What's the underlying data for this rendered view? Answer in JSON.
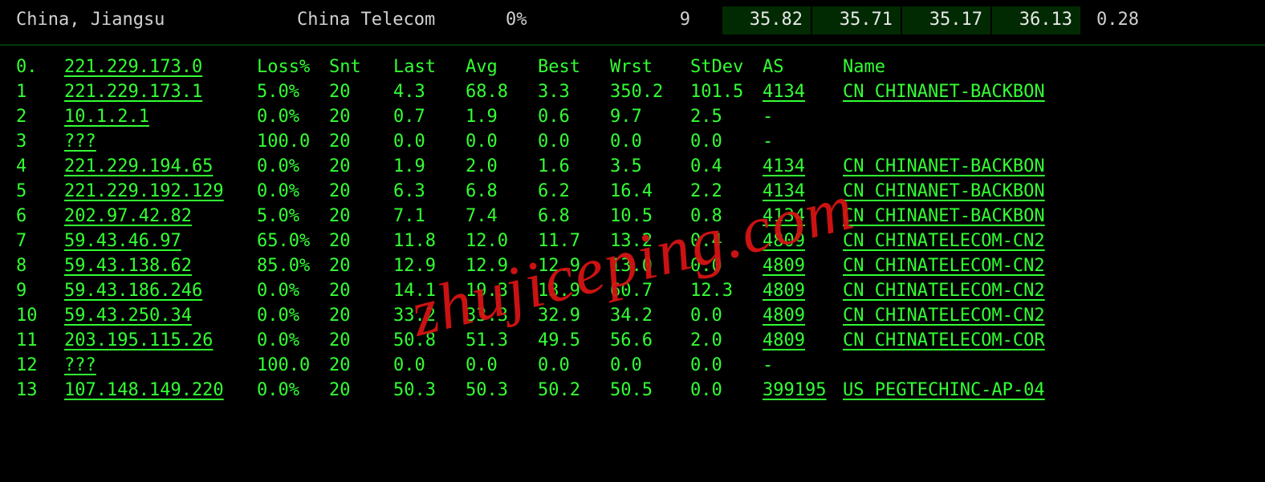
{
  "top": {
    "location": "China, Jiangsu",
    "isp": "China Telecom",
    "loss": "0%",
    "snt": "9",
    "stats": [
      "35.82",
      "35.71",
      "35.17",
      "36.13"
    ],
    "last": "0.28"
  },
  "headers": {
    "hop": "0.",
    "host": "221.229.173.0",
    "loss": "Loss%",
    "snt": "Snt",
    "last": "Last",
    "avg": "Avg",
    "best": "Best",
    "wrst": "Wrst",
    "stdev": "StDev",
    "asn": "AS",
    "asname": "Name"
  },
  "hops": [
    {
      "n": "1",
      "host": "221.229.173.1",
      "u": true,
      "loss": "5.0%",
      "snt": "20",
      "last": "4.3",
      "avg": "68.8",
      "best": "3.3",
      "wrst": "350.2",
      "stdev": "101.5",
      "asn": "4134",
      "asu": true,
      "asname": "CN CHINANET-BACKBON"
    },
    {
      "n": "2",
      "host": "10.1.2.1",
      "u": true,
      "loss": "0.0%",
      "snt": "20",
      "last": "0.7",
      "avg": "1.9",
      "best": "0.6",
      "wrst": "9.7",
      "stdev": "2.5",
      "asn": "-",
      "asu": false,
      "asname": ""
    },
    {
      "n": "3",
      "host": "???",
      "u": true,
      "loss": "100.0",
      "snt": "20",
      "last": "0.0",
      "avg": "0.0",
      "best": "0.0",
      "wrst": "0.0",
      "stdev": "0.0",
      "asn": "-",
      "asu": false,
      "asname": ""
    },
    {
      "n": "4",
      "host": "221.229.194.65",
      "u": true,
      "loss": "0.0%",
      "snt": "20",
      "last": "1.9",
      "avg": "2.0",
      "best": "1.6",
      "wrst": "3.5",
      "stdev": "0.4",
      "asn": "4134",
      "asu": true,
      "asname": "CN CHINANET-BACKBON"
    },
    {
      "n": "5",
      "host": "221.229.192.129",
      "u": true,
      "loss": "0.0%",
      "snt": "20",
      "last": "6.3",
      "avg": "6.8",
      "best": "6.2",
      "wrst": "16.4",
      "stdev": "2.2",
      "asn": "4134",
      "asu": true,
      "asname": "CN CHINANET-BACKBON"
    },
    {
      "n": "6",
      "host": "202.97.42.82",
      "u": true,
      "loss": "5.0%",
      "snt": "20",
      "last": "7.1",
      "avg": "7.4",
      "best": "6.8",
      "wrst": "10.5",
      "stdev": "0.8",
      "asn": "4134",
      "asu": true,
      "asname": "CN CHINANET-BACKBON"
    },
    {
      "n": "7",
      "host": "59.43.46.97",
      "u": true,
      "loss": "65.0%",
      "snt": "20",
      "last": "11.8",
      "avg": "12.0",
      "best": "11.7",
      "wrst": "13.2",
      "stdev": "0.4",
      "asn": "4809",
      "asu": true,
      "asname": "CN CHINATELECOM-CN2"
    },
    {
      "n": "8",
      "host": "59.43.138.62",
      "u": true,
      "loss": "85.0%",
      "snt": "20",
      "last": "12.9",
      "avg": "12.9",
      "best": "12.9",
      "wrst": "13.0",
      "stdev": "0.0",
      "asn": "4809",
      "asu": true,
      "asname": "CN CHINATELECOM-CN2"
    },
    {
      "n": "9",
      "host": "59.43.186.246",
      "u": true,
      "loss": "0.0%",
      "snt": "20",
      "last": "14.1",
      "avg": "19.3",
      "best": "13.9",
      "wrst": "60.7",
      "stdev": "12.3",
      "asn": "4809",
      "asu": true,
      "asname": "CN CHINATELECOM-CN2"
    },
    {
      "n": "10",
      "host": "59.43.250.34",
      "u": true,
      "loss": "0.0%",
      "snt": "20",
      "last": "33.2",
      "avg": "33.3",
      "best": "32.9",
      "wrst": "34.2",
      "stdev": "0.0",
      "asn": "4809",
      "asu": true,
      "asname": "CN CHINATELECOM-CN2"
    },
    {
      "n": "11",
      "host": "203.195.115.26",
      "u": true,
      "loss": "0.0%",
      "snt": "20",
      "last": "50.8",
      "avg": "51.3",
      "best": "49.5",
      "wrst": "56.6",
      "stdev": "2.0",
      "asn": "4809",
      "asu": true,
      "asname": "CN CHINATELECOM-COR"
    },
    {
      "n": "12",
      "host": "???",
      "u": true,
      "loss": "100.0",
      "snt": "20",
      "last": "0.0",
      "avg": "0.0",
      "best": "0.0",
      "wrst": "0.0",
      "stdev": "0.0",
      "asn": "-",
      "asu": false,
      "asname": ""
    },
    {
      "n": "13",
      "host": "107.148.149.220",
      "u": true,
      "loss": "0.0%",
      "snt": "20",
      "last": "50.3",
      "avg": "50.3",
      "best": "50.2",
      "wrst": "50.5",
      "stdev": "0.0",
      "asn": "399195",
      "asu": true,
      "asname": "US PEGTECHINC-AP-04"
    }
  ],
  "watermark": "zhujiceping.com"
}
